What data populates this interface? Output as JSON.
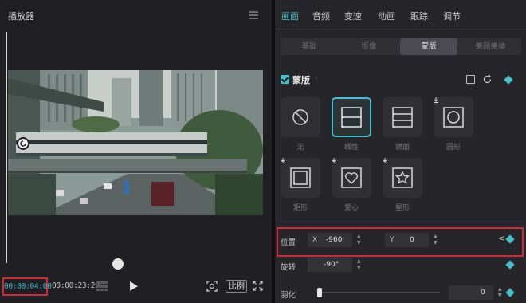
{
  "player": {
    "title": "播放器",
    "current_time": "00:00:04:00",
    "total_time": "00:00:23:29",
    "ratio_label": "比例"
  },
  "tabs": [
    {
      "label": "画面",
      "active": true
    },
    {
      "label": "音频",
      "active": false
    },
    {
      "label": "变速",
      "active": false
    },
    {
      "label": "动画",
      "active": false
    },
    {
      "label": "跟踪",
      "active": false
    },
    {
      "label": "调节",
      "active": false
    }
  ],
  "subtabs": [
    {
      "label": "基础",
      "active": false
    },
    {
      "label": "抠像",
      "active": false
    },
    {
      "label": "蒙版",
      "active": true
    },
    {
      "label": "美颜美体",
      "active": false
    }
  ],
  "mask_section": {
    "title": "蒙版",
    "chevron": "˅",
    "masks": [
      {
        "label": "无",
        "icon": "none-icon"
      },
      {
        "label": "线性",
        "icon": "linear-icon"
      },
      {
        "label": "镜面",
        "icon": "mirror-icon"
      },
      {
        "label": "圆形",
        "icon": "circle-icon"
      },
      {
        "label": "矩形",
        "icon": "rectangle-icon"
      },
      {
        "label": "爱心",
        "icon": "heart-icon"
      },
      {
        "label": "星形",
        "icon": "star-icon"
      }
    ]
  },
  "position": {
    "label": "位置",
    "x_label": "X",
    "x_value": "-960",
    "y_label": "Y",
    "y_value": "0",
    "prev_kf": "<"
  },
  "rotation": {
    "label": "旋转",
    "value": "-90°"
  },
  "feather": {
    "label": "羽化",
    "value": "0",
    "level": 0
  },
  "colors": {
    "accent": "#46c1cc",
    "highlight": "#d42a35"
  }
}
